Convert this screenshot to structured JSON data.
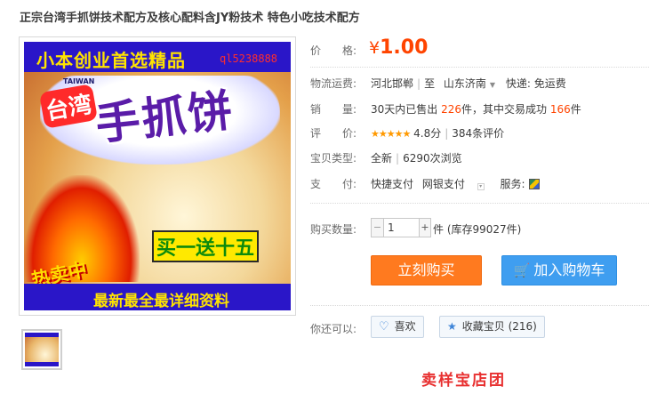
{
  "product": {
    "title": "正宗台湾手抓饼技术配方及核心配料含JY粉技术 特色小吃技术配方"
  },
  "image": {
    "slogan": "小本创业首选精品",
    "qq": "ql5238888",
    "taiwan_text": "台湾",
    "taiwan_en": "TAIWAN",
    "big_name": "手抓饼",
    "promo": "买一送十五",
    "hot": "热卖中",
    "bottom": "最新最全最详细资料"
  },
  "price": {
    "label": "价　　格:",
    "currency": "¥",
    "amount": "1.00"
  },
  "shipping": {
    "label": "物流运费:",
    "from": "河北邯郸",
    "to_prefix": "至",
    "to": "山东济南",
    "express": "快递: 免运费"
  },
  "sales": {
    "label": "销　　量:",
    "prefix": "30天内已售出",
    "count": "226",
    "middle": "件，其中交易成功",
    "success": "166",
    "suffix": "件"
  },
  "rating": {
    "label": "评　　价:",
    "stars": "★★★★★",
    "score": "4.8分",
    "reviews": "384条评价"
  },
  "condition": {
    "label": "宝贝类型:",
    "value": "全新",
    "views": "6290次浏览"
  },
  "payment": {
    "label": "支　　付:",
    "method1": "快捷支付",
    "method2": "网银支付",
    "service_label": "服务:"
  },
  "quantity": {
    "label": "购买数量:",
    "minus": "−",
    "value": "1",
    "plus": "+",
    "stock": "件 (库存99027件)"
  },
  "buttons": {
    "buy": "立刻购买",
    "cart": "加入购物车"
  },
  "more": {
    "label": "你还可以:",
    "like": "喜欢",
    "favorite": "收藏宝贝 (216)"
  },
  "footer_cut": "卖样宝店团"
}
